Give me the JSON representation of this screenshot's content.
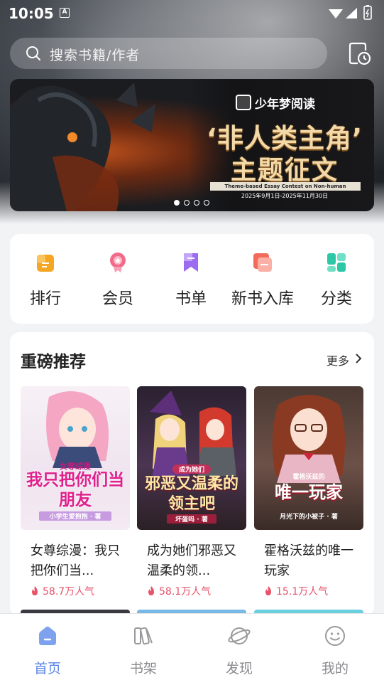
{
  "status_bar": {
    "time": "10:05",
    "indicator": "A"
  },
  "search": {
    "placeholder": "搜索书籍/作者"
  },
  "banner": {
    "brand": "少年梦阅读",
    "line1": "‘非人类主角’",
    "line2": "主题征文",
    "subtitle": "Theme-based Essay Contest on Non-human Protagonists",
    "date": "2025年9月1日-2025年11月30日",
    "page_count": 4,
    "active_page": 1
  },
  "nav": [
    {
      "label": "排行",
      "icon": "ranking-icon",
      "color": "#f5a623"
    },
    {
      "label": "会员",
      "icon": "vip-medal-icon",
      "color": "#f06a8a"
    },
    {
      "label": "书单",
      "icon": "booklist-bookmark-icon",
      "color": "#9b6cf0"
    },
    {
      "label": "新书入库",
      "icon": "new-books-icon",
      "color": "#f36b5a"
    },
    {
      "label": "分类",
      "icon": "category-grid-icon",
      "color": "#2cc8a6"
    }
  ],
  "recommend": {
    "title": "重磅推荐",
    "more": "更多",
    "books": [
      {
        "title": "女尊综漫：我只把你们当...",
        "popularity": "58.7万人气",
        "cover_title": "我只把你们当朋友",
        "cover_tag": "女尊综漫",
        "cover_author": "小学生爱抱抱 · 著"
      },
      {
        "title": "成为她们邪恶又温柔的领...",
        "popularity": "58.1万人气",
        "cover_title": "邪恶又温柔的领主吧",
        "cover_tag": "成为她们",
        "cover_author": "坏蛋吗 · 著"
      },
      {
        "title": "霍格沃兹的唯一玩家",
        "popularity": "15.1万人气",
        "cover_title": "唯一玩家",
        "cover_tag": "霍格沃兹的",
        "cover_author": "月光下的小被子 · 著"
      }
    ]
  },
  "tabbar": [
    {
      "label": "首页",
      "icon": "home-icon",
      "active": true
    },
    {
      "label": "书架",
      "icon": "bookshelf-icon",
      "active": false
    },
    {
      "label": "发现",
      "icon": "discover-planet-icon",
      "active": false
    },
    {
      "label": "我的",
      "icon": "profile-smile-icon",
      "active": false
    }
  ],
  "colors": {
    "accent": "#5a84e6",
    "popularity": "#e8526a"
  }
}
